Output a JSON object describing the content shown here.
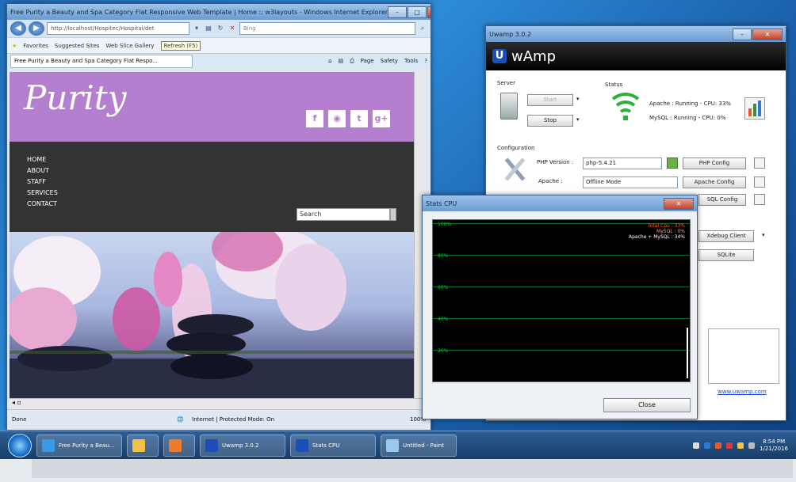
{
  "browser": {
    "title": "Free Purity a Beauty and Spa Category Flat Responsive Web Template | Home :: w3layouts - Windows Internet Explorer",
    "address": "http://localhost/Hospitec/Hospital/det",
    "search_placeholder": "Bing",
    "favorites_label": "Favorites",
    "suggested_sites": "Suggested Sites",
    "web_slice": "Web Slice Gallery",
    "refresh_tooltip": "Refresh (F5)",
    "tab_title": "Free Purity a Beauty and Spa Category Flat Respo...",
    "commands": [
      "Page",
      "Safety",
      "Tools"
    ],
    "status_left": "Done",
    "status_zone": "Internet | Protected Mode: On",
    "zoom": "100%"
  },
  "site": {
    "logo": "Purity",
    "social": [
      "f",
      "rss",
      "t",
      "g+"
    ],
    "nav": [
      "HOME",
      "ABOUT",
      "STAFF",
      "SERVICES",
      "CONTACT"
    ],
    "search_value": "Search"
  },
  "wamp": {
    "window_title": "Uwamp 3.0.2",
    "app_name": "wAmp",
    "server_label": "Server",
    "start_label": "Start",
    "stop_label": "Stop",
    "status_label": "Status",
    "apache_status": "Apache : Running - CPU: 33%",
    "mysql_status": "MySQL : Running - CPU: 0%",
    "configuration_label": "Configuration",
    "php_version_label": "PHP Version :",
    "php_version_value": "php-5.4.21",
    "php_config": "PHP Config",
    "apache_label": "Apache :",
    "apache_mode": "Offline Mode",
    "apache_config": "Apache Config",
    "mysql_config": "SQL Config",
    "xdebug_client": "Xdebug Client",
    "sqlite": "SQLite",
    "website_link": "www.uwamp.com"
  },
  "stats": {
    "title": "Stats CPU",
    "legend": [
      "Total Cpu : 33%",
      "MySQL : 0%",
      "Apache + MySQL : 34%"
    ],
    "grid_labels": [
      "100%",
      "80%",
      "60%",
      "40%",
      "20%"
    ],
    "close_label": "Close"
  },
  "taskbar": {
    "items": [
      "Free Purity a Beau...",
      "",
      "",
      "Uwamp 3.0.2",
      "Stats CPU",
      "Untitled - Paint"
    ],
    "time": "8:54 PM",
    "date": "1/21/2016"
  },
  "colors": {
    "site_header": "#b57fd0",
    "site_nav": "#333333",
    "wamp_header": "#000000",
    "graph_bg": "#000000",
    "graph_grid": "#0a6b2a",
    "apache_legend": "#ff6040"
  }
}
